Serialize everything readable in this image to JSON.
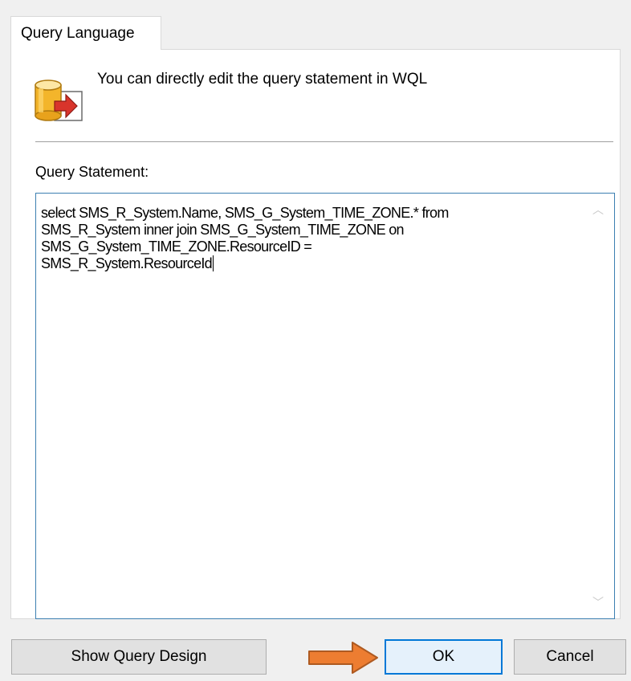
{
  "tab": {
    "label": "Query Language"
  },
  "header": {
    "description": "You can directly edit the query statement in WQL",
    "icon": "database-import-icon"
  },
  "editor": {
    "label": "Query Statement:",
    "value": "select SMS_R_System.Name, SMS_G_System_TIME_ZONE.* from\nSMS_R_System inner join SMS_G_System_TIME_ZONE on\nSMS_G_System_TIME_ZONE.ResourceID =\nSMS_R_System.ResourceId"
  },
  "buttons": {
    "show_query_design": "Show Query Design",
    "ok": "OK",
    "cancel": "Cancel"
  },
  "annotation": {
    "arrow_color": "#ed7d31",
    "arrow_border": "#ae5a21"
  },
  "colors": {
    "focus_border": "#0078d7",
    "editor_border": "#3c7fb1"
  }
}
